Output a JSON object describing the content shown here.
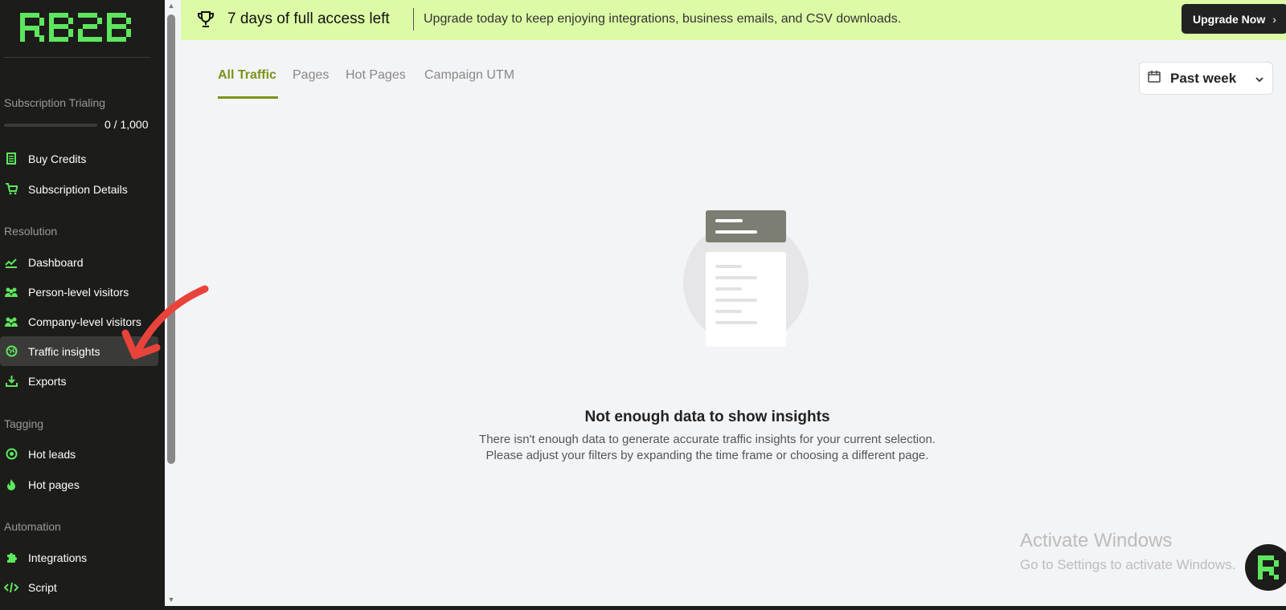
{
  "logo": "RB2B",
  "sidebar": {
    "subscription": {
      "label": "Subscription Trialing",
      "progress_text": "0 / 1,000",
      "progress": 0
    },
    "items_top": [
      {
        "label": "Buy Credits",
        "icon": "receipt-icon"
      },
      {
        "label": "Subscription Details",
        "icon": "cart-icon"
      }
    ],
    "sections": {
      "resolution": "Resolution",
      "tagging": "Tagging",
      "automation": "Automation"
    },
    "resolution_items": [
      {
        "label": "Dashboard",
        "icon": "chart-icon"
      },
      {
        "label": "Person-level visitors",
        "icon": "people-icon"
      },
      {
        "label": "Company-level visitors",
        "icon": "people-icon"
      },
      {
        "label": "Traffic insights",
        "icon": "globe-icon",
        "active": true
      },
      {
        "label": "Exports",
        "icon": "download-icon"
      }
    ],
    "tagging_items": [
      {
        "label": "Hot leads",
        "icon": "target-icon"
      },
      {
        "label": "Hot pages",
        "icon": "flame-icon"
      }
    ],
    "automation_items": [
      {
        "label": "Integrations",
        "icon": "puzzle-icon"
      },
      {
        "label": "Script",
        "icon": "code-icon"
      }
    ]
  },
  "banner": {
    "title": "7 days of full access left",
    "text": "Upgrade today to keep enjoying integrations, business emails, and CSV downloads.",
    "button": "Upgrade Now"
  },
  "tabs": [
    "All Traffic",
    "Pages",
    "Hot Pages",
    "Campaign UTM"
  ],
  "date_filter": "Past week",
  "empty_state": {
    "title": "Not enough data to show insights",
    "line1": "There isn't enough data to generate accurate traffic insights for your current selection.",
    "line2": "Please adjust your filters by expanding the time frame or choosing a different page."
  },
  "watermark": {
    "title": "Activate Windows",
    "sub": "Go to Settings to activate Windows."
  },
  "colors": {
    "accent": "#5ee65e",
    "banner": "#ddfba6",
    "tab_active": "#7a9318",
    "sidebar": "#1c1c1a"
  }
}
